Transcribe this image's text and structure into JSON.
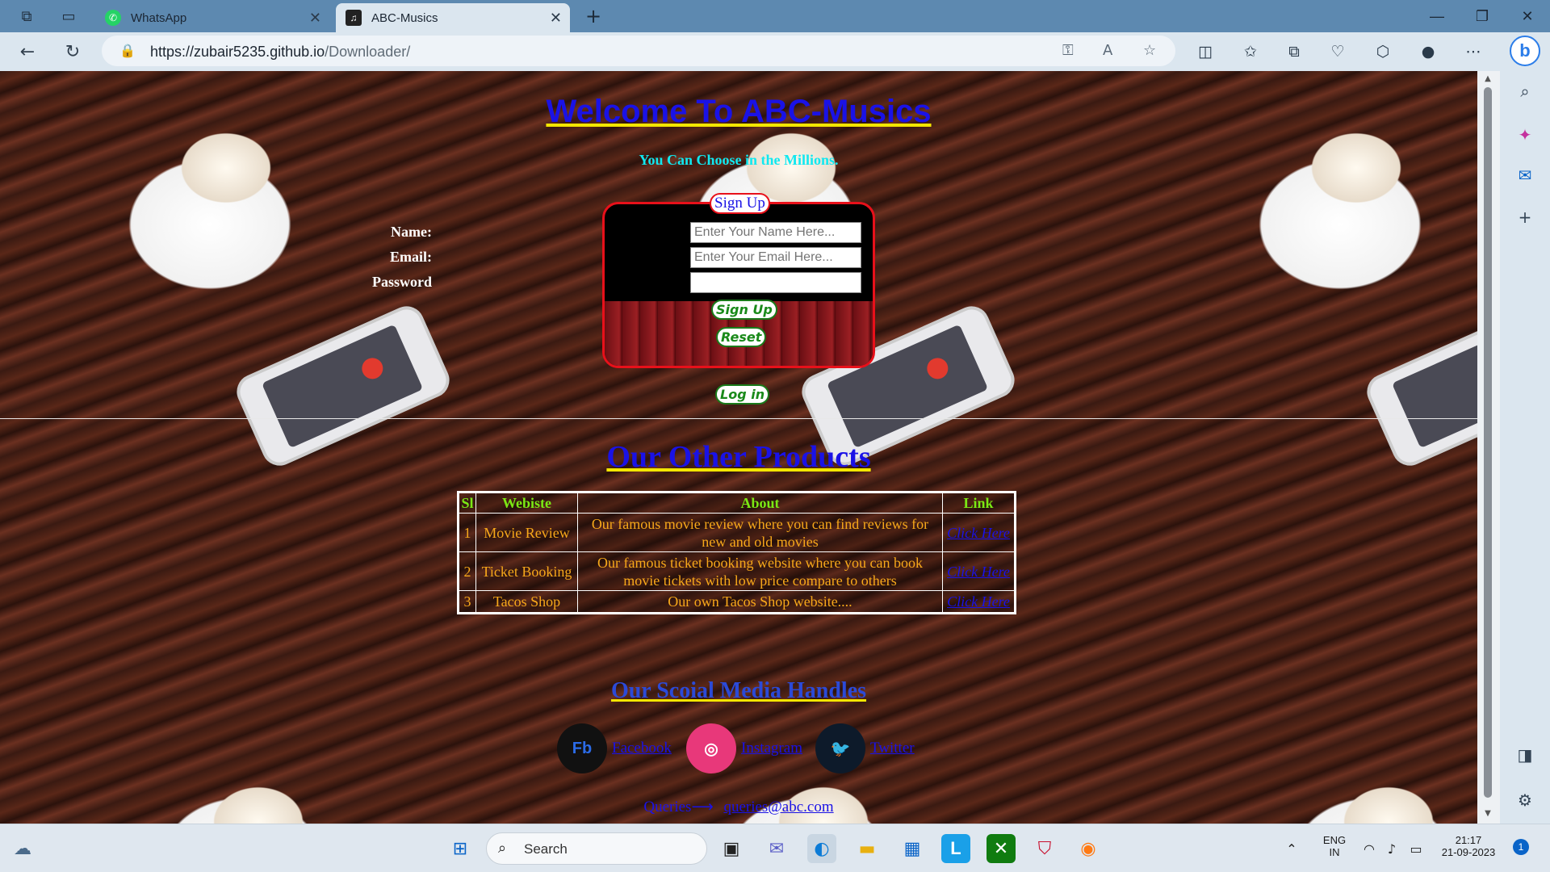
{
  "browser": {
    "tabs": [
      {
        "title": "WhatsApp",
        "active": false
      },
      {
        "title": "ABC-Musics",
        "active": true
      }
    ],
    "url_prefix": "https://zubair5235.github.io",
    "url_path": "/Downloader/"
  },
  "page": {
    "welcome_title": "Welcome To ABC-Musics",
    "subtitle": "You Can Choose in the Millions.",
    "signup": {
      "legend": "Sign Up",
      "fields": [
        {
          "label": "Name:",
          "placeholder": "Enter Your Name Here..."
        },
        {
          "label": "Email:",
          "placeholder": "Enter Your Email Here..."
        },
        {
          "label": "Password",
          "placeholder": ""
        }
      ],
      "signup_button": "Sign Up",
      "reset_button": "Reset"
    },
    "login_button": "Log in",
    "products_title": "Our Other Products",
    "products_table": {
      "headers": [
        "Sl",
        "Webiste",
        "About",
        "Link"
      ],
      "rows": [
        {
          "sl": "1",
          "site": "Movie Review",
          "about": "Our famous movie review where you can find reviews for new and old movies",
          "link": "Click Here"
        },
        {
          "sl": "2",
          "site": "Ticket Booking",
          "about": "Our famous ticket booking website where you can book movie tickets with low price compare to others",
          "link": "Click Here"
        },
        {
          "sl": "3",
          "site": "Tacos Shop",
          "about": "Our own Tacos Shop website....",
          "link": "Click Here"
        }
      ]
    },
    "social_title": "Our Scoial Media Handles",
    "social": [
      {
        "name": "Facebook",
        "icon": "facebook-icon"
      },
      {
        "name": "Instagram",
        "icon": "instagram-icon"
      },
      {
        "name": "Twitter",
        "icon": "twitter-icon"
      }
    ],
    "queries_label": "Queries⟶",
    "queries_email": "queries@abc.com"
  },
  "taskbar": {
    "search_label": "Search",
    "lang_top": "ENG",
    "lang_bottom": "IN",
    "time": "21:17",
    "date": "21-09-2023",
    "notification_count": "1"
  },
  "colors": {
    "heading_blue": "#1a12e6",
    "underline_yellow": "#f3e600",
    "subtitle_cyan": "#10e8f0",
    "table_header_green": "#7be814",
    "table_text_orange": "#f7a81a",
    "form_border_red": "#e8101a"
  }
}
